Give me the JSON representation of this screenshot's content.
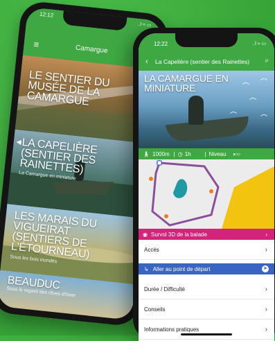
{
  "back_phone": {
    "status_time": "12:12",
    "status_icons": "..l ≈ ▭",
    "header_title": "Camargue",
    "menu_icon": "hamburger-icon",
    "cards": [
      {
        "title": "LE SENTIER DU MUSÉE DE LA CAMARGUE",
        "subtitle": ""
      },
      {
        "title": "LA CAPELIÈRE (SENTIER DES RAINETTES)",
        "subtitle": "La Camargue en miniature"
      },
      {
        "title": "LES MARAIS DU VIGUEIRAT (SENTIERS DE L'ÉTOURNEAU)",
        "subtitle": "Sous les bois inondés"
      },
      {
        "title": "BEAUDUC",
        "subtitle": "Sous le regard des rêves d'hiver"
      }
    ]
  },
  "front_phone": {
    "status_time": "12:22",
    "status_icons": "..l ≈ ▭",
    "header_title": "La Capelière (sentier des Rainettes)",
    "back_icon": "chevron-left-icon",
    "search_icon": "search-icon",
    "hero_title": "LA CAMARGUE EN MINIATURE",
    "stats": {
      "distance": "1000m",
      "duration": "1h",
      "level_label": "Niveau"
    },
    "survol_label": "Survol 3D de la balade",
    "rows": {
      "acces": "Accès",
      "goto": "Aller au point de départ",
      "duree": "Durée / Difficulté",
      "conseils": "Conseils",
      "infos": "Informations pratiques"
    },
    "colors": {
      "green": "#3fa843",
      "magenta": "#d4247a",
      "blue": "#3a64c4"
    }
  }
}
